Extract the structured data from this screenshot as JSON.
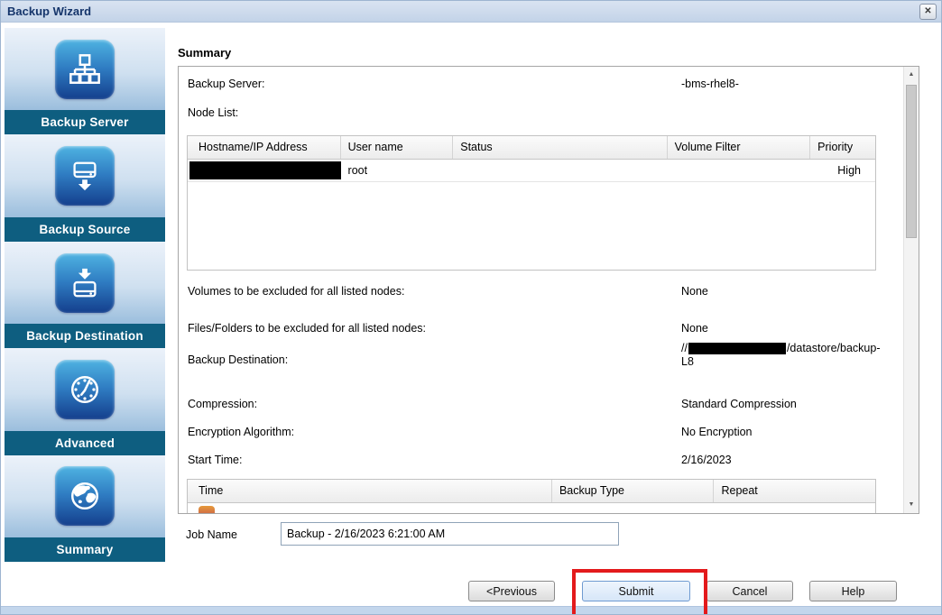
{
  "window": {
    "title": "Backup Wizard"
  },
  "icons": {
    "close": "✕",
    "scroll_up": "▲",
    "scroll_down": "▼"
  },
  "sidebar": {
    "items": [
      {
        "label": "Backup Server",
        "icon": "network-icon"
      },
      {
        "label": "Backup Source",
        "icon": "drive-download-icon"
      },
      {
        "label": "Backup Destination",
        "icon": "download-to-drive-icon"
      },
      {
        "label": "Advanced",
        "icon": "clock-icon"
      },
      {
        "label": "Summary",
        "icon": "globe-icon"
      }
    ]
  },
  "summary": {
    "heading": "Summary",
    "fields": {
      "backup_server": {
        "label": "Backup Server:",
        "value": "-bms-rhel8-"
      },
      "node_list": {
        "label": "Node List:"
      },
      "volumes_excluded": {
        "label": "Volumes to be excluded for all listed nodes:",
        "value": "None"
      },
      "files_excluded": {
        "label": "Files/Folders to be excluded for all listed nodes:",
        "value": "None"
      },
      "backup_destination": {
        "label": "Backup Destination:",
        "value_prefix": "//",
        "value_suffix": "/datastore/backup-",
        "value_wrap": "L8",
        "middle_redacted": true
      },
      "compression": {
        "label": "Compression:",
        "value": "Standard Compression"
      },
      "encryption": {
        "label": "Encryption Algorithm:",
        "value": "No Encryption"
      },
      "start_time": {
        "label": "Start Time:",
        "value": "2/16/2023"
      }
    },
    "node_table": {
      "headers": [
        "Hostname/IP Address",
        "User name",
        "Status",
        "Volume Filter",
        "Priority"
      ],
      "rows": [
        {
          "hostname_redacted": true,
          "user_name": "root",
          "status": "",
          "volume_filter": "",
          "priority": "High"
        }
      ]
    },
    "schedule_table": {
      "headers": [
        "Time",
        "Backup Type",
        "Repeat"
      ]
    }
  },
  "job_name": {
    "label": "Job Name",
    "value": "Backup - 2/16/2023 6:21:00 AM"
  },
  "buttons": {
    "previous": "<Previous",
    "submit": "Submit",
    "cancel": "Cancel",
    "help": "Help"
  },
  "colors": {
    "sidebar_label_bg": "#0e5e80",
    "icon_blue_top": "#4fb3e2",
    "icon_blue_bottom": "#143f8d",
    "title_text": "#15356b",
    "annotation_red": "#e31a1c"
  }
}
